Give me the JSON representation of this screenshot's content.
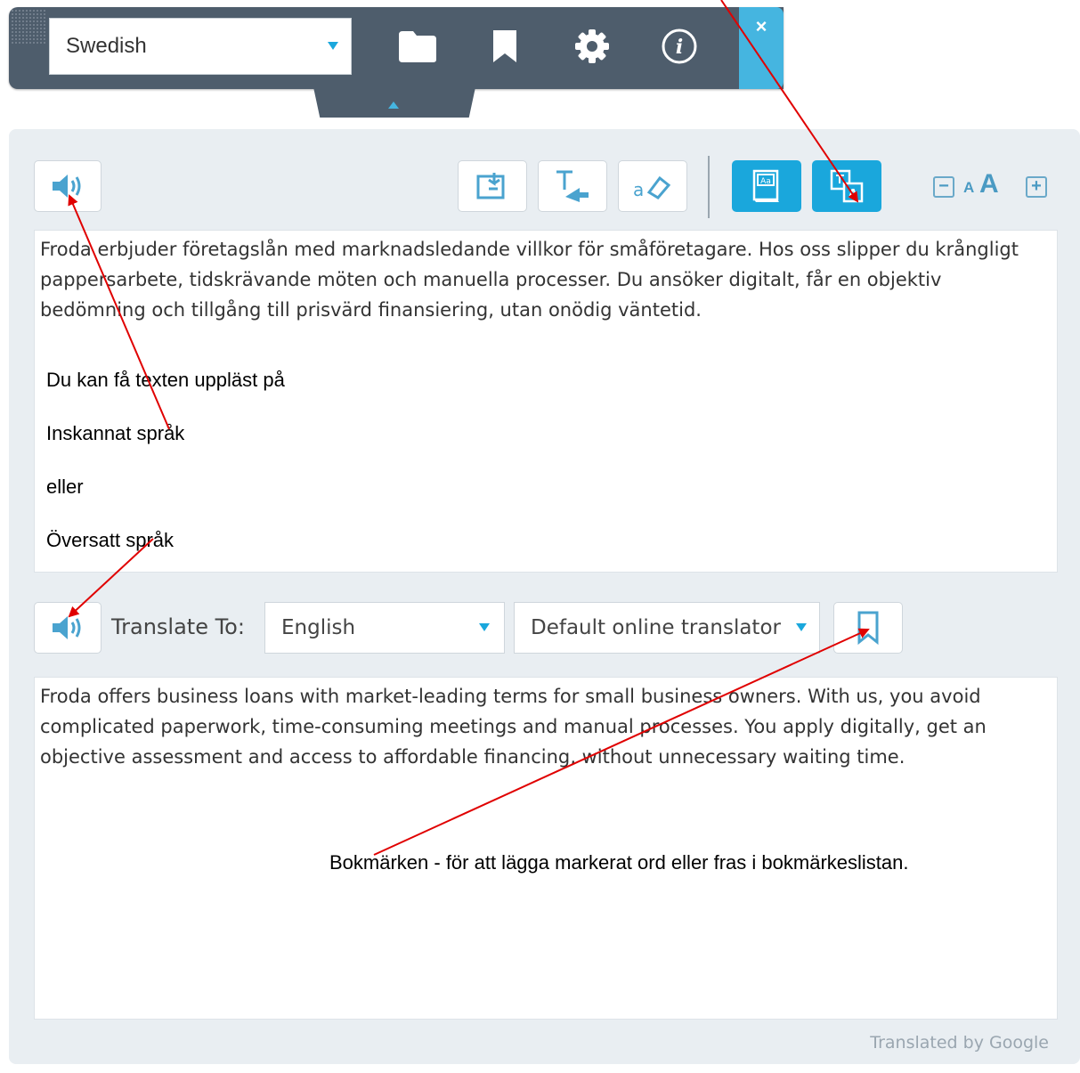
{
  "toolbar": {
    "language": "Swedish",
    "close_label": "×",
    "icons": [
      "folder-icon",
      "bookmark-icon",
      "gear-icon",
      "info-icon"
    ]
  },
  "tools": {
    "font_small": "A",
    "font_large": "A",
    "minus": "−",
    "plus": "+"
  },
  "source_text": "Froda erbjuder företagslån med marknadsledande villkor för småföretagare. Hos oss slipper du krångligt pappersarbete, tidskrävande möten och manuella processer. Du ansöker digitalt, får en objektiv bedömning och tillgång till prisvärd finansiering, utan onödig väntetid.",
  "annotations": {
    "read_aloud": "Du kan få texten uppläst på",
    "scanned": "Inskannat språk",
    "or": "eller",
    "translated": "Översatt språk",
    "bookmarks": "Bokmärken - för att lägga markerat ord eller fras i bokmärkeslistan."
  },
  "translate": {
    "label": "Translate To:",
    "target_language": "English",
    "translator": "Default online translator"
  },
  "translated_text": "Froda offers business loans with market-leading terms for small business owners. With us, you avoid complicated paperwork, time-consuming meetings and manual processes. You apply digitally, get an objective assessment and access to affordable financing, without unnecessary waiting time.",
  "footer": "Translated by Google",
  "colors": {
    "accent": "#1aa7dc",
    "toolbar": "#4e5d6c",
    "panel": "#e9eef2",
    "arrow": "#e00000"
  }
}
